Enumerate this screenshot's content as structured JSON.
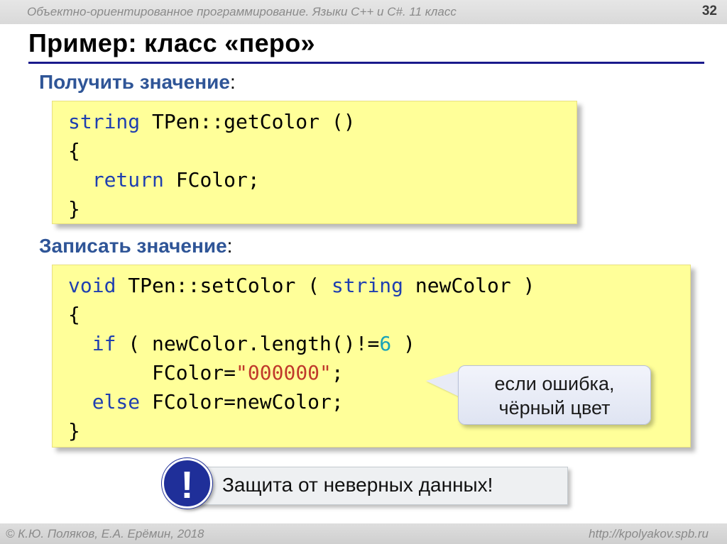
{
  "header": {
    "course_title": "Объектно-ориентированное программирование. Языки C++ и C#. 11 класс",
    "page_number": "32"
  },
  "slide": {
    "title": "Пример: класс «перо»"
  },
  "get_section": {
    "label": "Получить значение",
    "colon": ":",
    "code": {
      "l1_kw": "string",
      "l1_rest": " TPen::getColor ()",
      "l2": "{",
      "l3_indent": "  ",
      "l3_kw": "return",
      "l3_rest": " FColor;",
      "l4": "}"
    }
  },
  "set_section": {
    "label": "Записать значение",
    "colon": ":",
    "code": {
      "l1_kw1": "void",
      "l1_mid": " TPen::setColor ( ",
      "l1_kw2": "string",
      "l1_rest": " newColor )",
      "l2": "{",
      "l3_indent": "  ",
      "l3_kw": "if",
      "l3_mid": " ( newColor.length()!=",
      "l3_num": "6",
      "l3_rest": " )",
      "l4_indent": "       ",
      "l4_pre": "FColor=",
      "l4_str": "\"000000\"",
      "l4_rest": ";",
      "l5_indent": "  ",
      "l5_kw": "else",
      "l5_rest": " FColor=newColor;",
      "l6": "}"
    }
  },
  "callout": {
    "line1": "если ошибка,",
    "line2": "чёрный цвет"
  },
  "alert": {
    "icon_glyph": "!",
    "text": "Защита от неверных данных!"
  },
  "footer": {
    "authors": "© К.Ю. Поляков, Е.А. Ерёмин, 2018",
    "url": "http://kpolyakov.spb.ru"
  },
  "colors": {
    "keyword": "#1f3fb0",
    "section_label": "#2f5597",
    "code_background": "#ffff99",
    "alert_icon": "#1f2f99"
  }
}
